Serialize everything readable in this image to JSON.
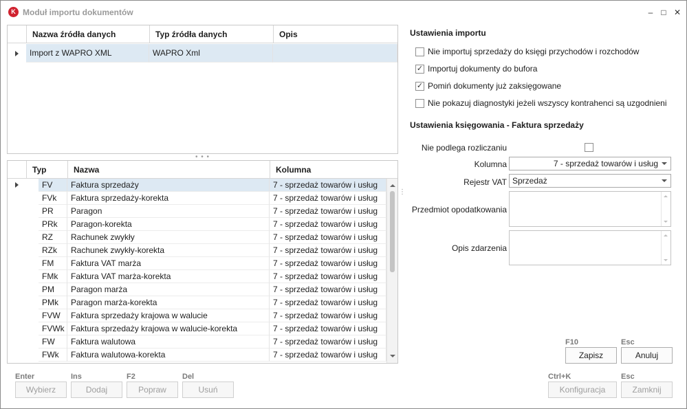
{
  "window": {
    "title": "Moduł importu dokumentów",
    "icon_letter": "K",
    "controls": {
      "minimize": "–",
      "maximize": "□",
      "close": "✕"
    }
  },
  "sources_grid": {
    "columns": [
      "Nazwa źródła danych",
      "Typ źródła danych",
      "Opis"
    ],
    "rows": [
      {
        "name": "Import z WAPRO XML",
        "type": "WAPRO Xml",
        "desc": ""
      }
    ]
  },
  "types_grid": {
    "columns": [
      "Typ",
      "Nazwa",
      "Kolumna"
    ],
    "rows": [
      {
        "typ": "FV",
        "nazwa": "Faktura sprzedaży",
        "kolumna": "7 - sprzedaż towarów i usług"
      },
      {
        "typ": "FVk",
        "nazwa": "Faktura sprzedaży-korekta",
        "kolumna": "7 - sprzedaż towarów i usług"
      },
      {
        "typ": "PR",
        "nazwa": "Paragon",
        "kolumna": "7 - sprzedaż towarów i usług"
      },
      {
        "typ": "PRk",
        "nazwa": "Paragon-korekta",
        "kolumna": "7 - sprzedaż towarów i usług"
      },
      {
        "typ": "RZ",
        "nazwa": "Rachunek zwykły",
        "kolumna": "7 - sprzedaż towarów i usług"
      },
      {
        "typ": "RZk",
        "nazwa": "Rachunek zwykły-korekta",
        "kolumna": "7 - sprzedaż towarów i usług"
      },
      {
        "typ": "FM",
        "nazwa": "Faktura VAT marża",
        "kolumna": "7 - sprzedaż towarów i usług"
      },
      {
        "typ": "FMk",
        "nazwa": "Faktura VAT marża-korekta",
        "kolumna": "7 - sprzedaż towarów i usług"
      },
      {
        "typ": "PM",
        "nazwa": "Paragon marża",
        "kolumna": "7 - sprzedaż towarów i usług"
      },
      {
        "typ": "PMk",
        "nazwa": "Paragon marża-korekta",
        "kolumna": "7 - sprzedaż towarów i usług"
      },
      {
        "typ": "FVW",
        "nazwa": "Faktura sprzedaży krajowa w walucie",
        "kolumna": "7 - sprzedaż towarów i usług"
      },
      {
        "typ": "FVWk",
        "nazwa": "Faktura sprzedaży krajowa w walucie-korekta",
        "kolumna": "7 - sprzedaż towarów i usług"
      },
      {
        "typ": "FW",
        "nazwa": "Faktura walutowa",
        "kolumna": "7 - sprzedaż towarów i usług"
      },
      {
        "typ": "FWk",
        "nazwa": "Faktura walutowa-korekta",
        "kolumna": "7 - sprzedaż towarów i usług"
      }
    ]
  },
  "import_settings": {
    "title": "Ustawienia importu",
    "options": [
      {
        "label": "Nie importuj sprzedaży do księgi przychodów i rozchodów",
        "checked": false
      },
      {
        "label": "Importuj dokumenty do bufora",
        "checked": true
      },
      {
        "label": "Pomiń dokumenty już zaksięgowane",
        "checked": true
      },
      {
        "label": "Nie pokazuj diagnostyki jeżeli wszyscy kontrahenci są uzgodnieni",
        "checked": false
      }
    ]
  },
  "posting_settings": {
    "title": "Ustawienia księgowania - Faktura sprzedaży",
    "not_settled_label": "Nie podlega rozliczaniu",
    "not_settled_checked": false,
    "kolumna_label": "Kolumna",
    "kolumna_value": "7 - sprzedaż towarów i usług",
    "rejestr_label": "Rejestr VAT",
    "rejestr_value": "Sprzedaż",
    "przedmiot_label": "Przedmiot opodatkowania",
    "przedmiot_value": "",
    "opis_label": "Opis zdarzenia",
    "opis_value": ""
  },
  "dialog_buttons": {
    "save": {
      "hotkey": "F10",
      "label": "Zapisz"
    },
    "cancel": {
      "hotkey": "Esc",
      "label": "Anuluj"
    }
  },
  "bottom_left_buttons": [
    {
      "hotkey": "Enter",
      "label": "Wybierz"
    },
    {
      "hotkey": "Ins",
      "label": "Dodaj"
    },
    {
      "hotkey": "F2",
      "label": "Popraw"
    },
    {
      "hotkey": "Del",
      "label": "Usuń"
    }
  ],
  "bottom_right_buttons": [
    {
      "hotkey": "Ctrl+K",
      "label": "Konfiguracja"
    },
    {
      "hotkey": "Esc",
      "label": "Zamknij"
    }
  ],
  "glyphs": {
    "check": "✓",
    "splitter_h": "• • •",
    "splitter_v": "⋮"
  }
}
